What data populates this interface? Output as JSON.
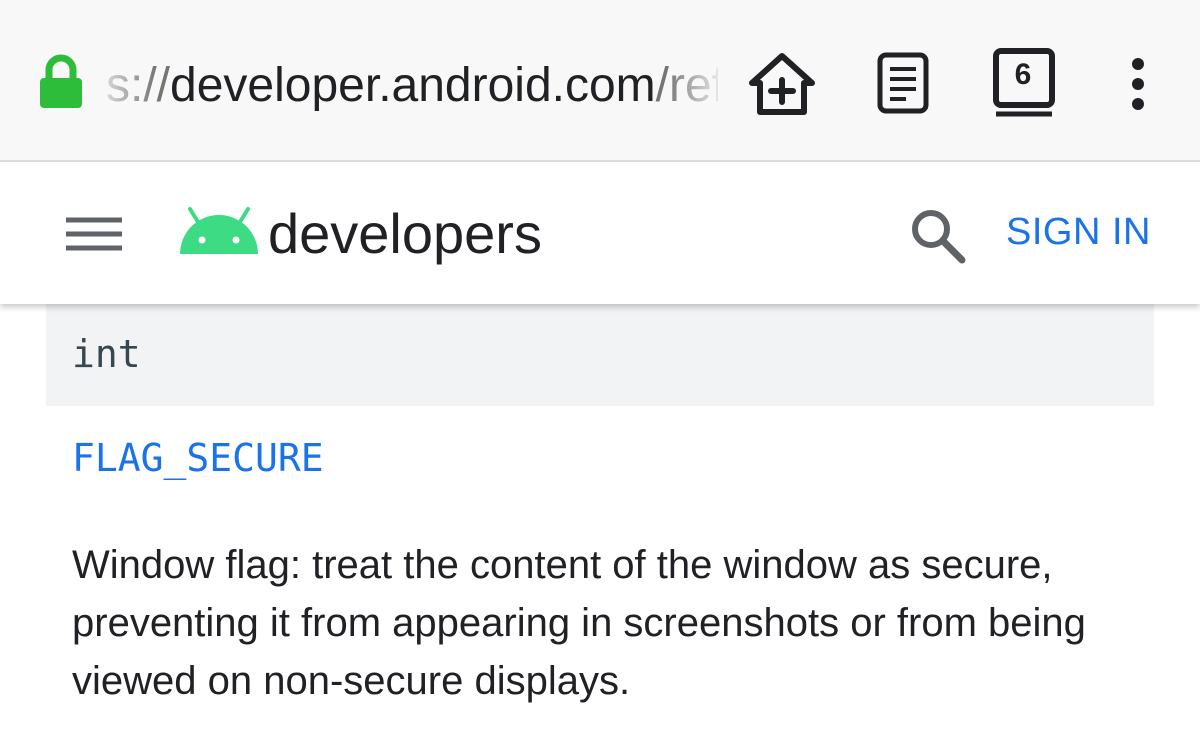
{
  "browser": {
    "url_scheme": "s://",
    "url_host": "developer.android.com",
    "url_path": "/ref",
    "tab_count": "6",
    "icons": {
      "lock": "lock-icon",
      "home": "home-add-icon",
      "reader": "reader-mode-icon",
      "tabs": "tab-switcher-icon",
      "menu": "overflow-menu-icon"
    },
    "colors": {
      "lock": "#2ebd3a"
    }
  },
  "header": {
    "brand": "developers",
    "sign_in_label": "SIGN IN",
    "icons": {
      "menu": "hamburger-menu-icon",
      "logo": "android-logo-icon",
      "search": "search-icon"
    },
    "colors": {
      "android_green": "#3ddc84",
      "link_blue": "#1a73e8"
    }
  },
  "content": {
    "code_type": "int",
    "constant_name": "FLAG_SECURE",
    "description": "Window flag: treat the content of the window as secure, preventing it from appearing in screenshots or from being viewed on non-secure displays."
  }
}
